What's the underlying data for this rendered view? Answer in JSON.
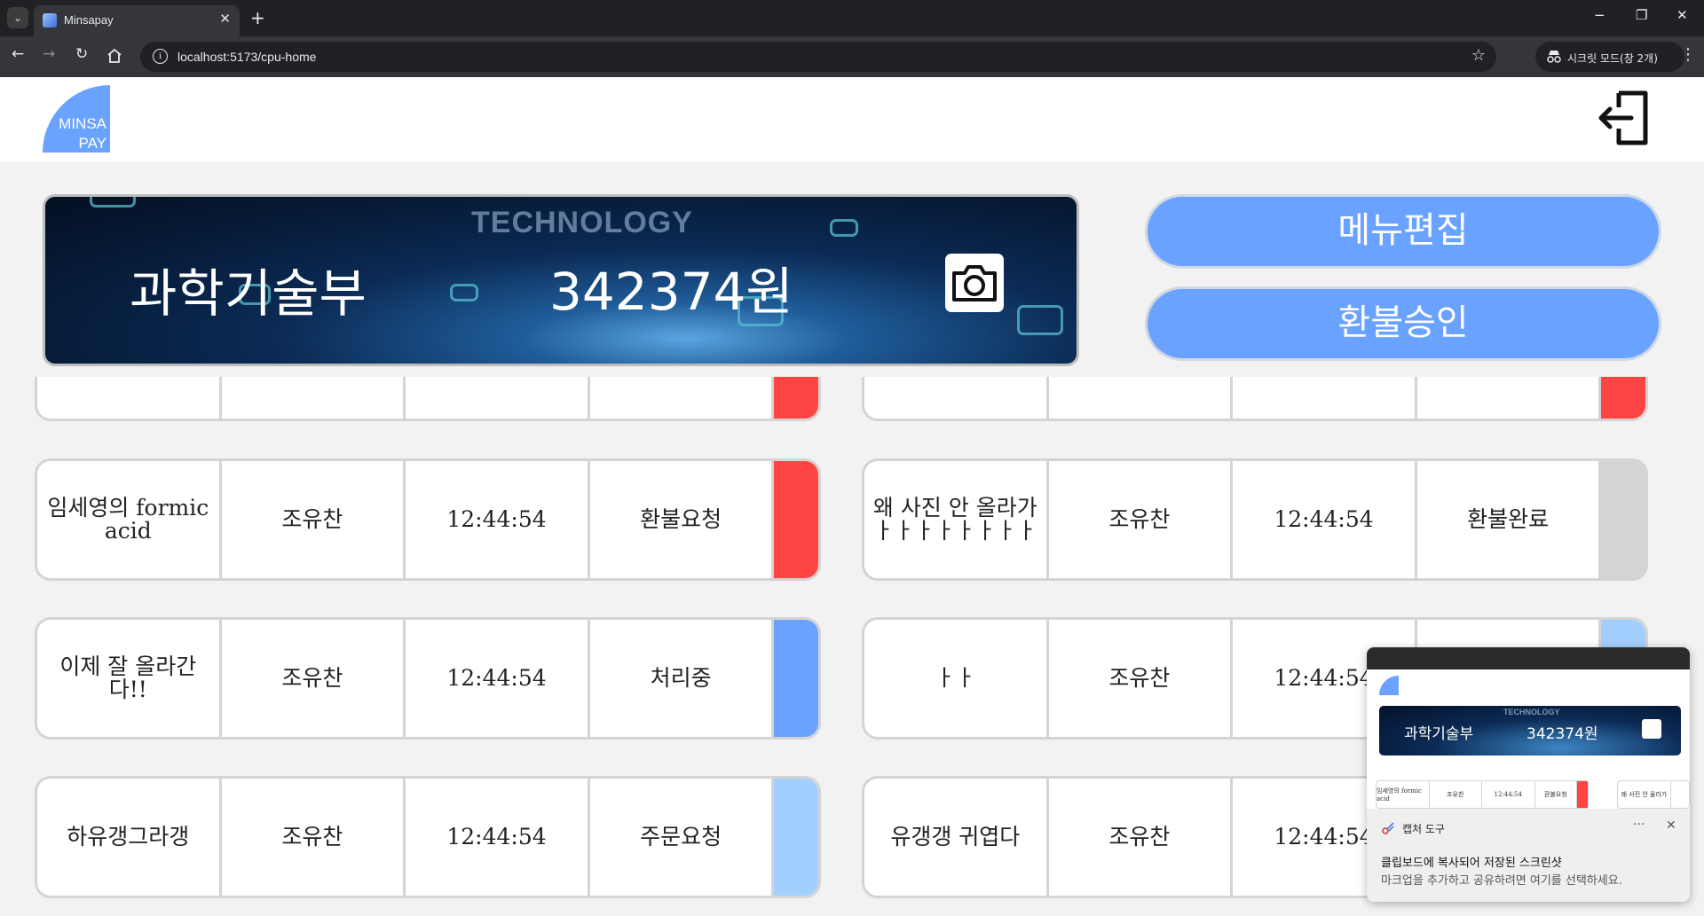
{
  "browser": {
    "tab_title": "Minsapay",
    "tab_close": "✕",
    "new_tab": "+",
    "url": "localhost:5173/cpu-home",
    "incognito_label": "시크릿 모드(창 2개)",
    "minimize": "−",
    "restore": "❐",
    "close": "✕"
  },
  "header": {
    "logo_line1": "MINSA",
    "logo_line2": "PAY"
  },
  "banner": {
    "tech_word": "TECHNOLOGY",
    "department": "과학기술부",
    "balance": "342374원"
  },
  "actions": {
    "menu_edit": "메뉴편집",
    "refund_approve": "환불승인"
  },
  "colors": {
    "accent": "#6aa3ff",
    "status_red": "#ff4444",
    "status_blue": "#6aa3ff",
    "status_lightblue": "#a3cfff",
    "status_gray": "#d4d4d4"
  },
  "orders": {
    "left": [
      {
        "item": "임세영의 formic acid",
        "name": "조유찬",
        "time": "12:44:54",
        "status": "환불요청",
        "color": "#ff4444"
      },
      {
        "item": "이제 잘 올라간다!!",
        "name": "조유찬",
        "time": "12:44:54",
        "status": "처리중",
        "color": "#6aa3ff"
      },
      {
        "item": "하유갱그라갱",
        "name": "조유찬",
        "time": "12:44:54",
        "status": "주문요청",
        "color": "#a3cfff"
      }
    ],
    "right": [
      {
        "item": "왜 사진 안 올라가ㅏㅏㅏㅏㅏㅏㅏㅏ",
        "name": "조유찬",
        "time": "12:44:54",
        "status": "환불완료",
        "color": "#d4d4d4"
      },
      {
        "item": "ㅏㅏ",
        "name": "조유찬",
        "time": "12:44:54",
        "status": "",
        "color": "#a3cfff"
      },
      {
        "item": "유갱갱 귀엽다",
        "name": "조유찬",
        "time": "12:44:54",
        "status": "",
        "color": "#a3cfff"
      }
    ]
  },
  "capture_toast": {
    "app_name": "캡처 도구",
    "more": "···",
    "close": "✕",
    "title": "클립보드에 복사되어 저장된 스크린샷",
    "description": "마크업을 추가하고 공유하려면 여기를 선택하세요.",
    "preview_department": "과학기술부",
    "preview_balance": "342374원",
    "preview_tech": "TECHNOLOGY",
    "preview_row": [
      "임세영의 formic acid",
      "조유찬",
      "12:44:54",
      "환불요청"
    ],
    "preview_row2": "왜 사진 안 올라가"
  }
}
